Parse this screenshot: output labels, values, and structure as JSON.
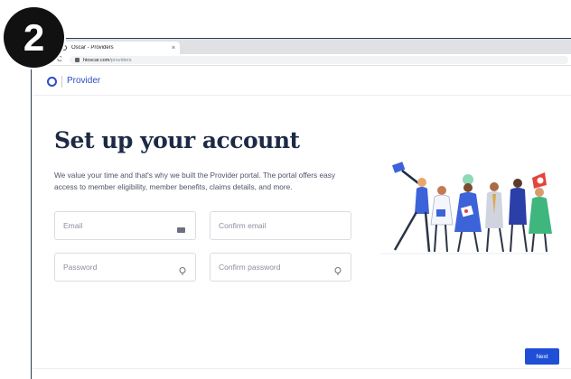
{
  "step": {
    "number": "2"
  },
  "browser": {
    "tab": {
      "title": "Oscar - Providers",
      "close": "×"
    },
    "address": {
      "reload": "C",
      "host": "hioscar.com",
      "path": "/providers"
    }
  },
  "header": {
    "brand": "Provider"
  },
  "main": {
    "title": "Set up your account",
    "subtitle": "We value your time and that's why we built the Provider portal. The portal offers easy access to member eligibility, member benefits, claims details, and more.",
    "fields": {
      "email": {
        "placeholder": "Email",
        "value": ""
      },
      "confirm_email": {
        "placeholder": "Confirm email",
        "value": ""
      },
      "password": {
        "placeholder": "Password",
        "value": ""
      },
      "confirm_password": {
        "placeholder": "Confirm password",
        "value": ""
      }
    }
  },
  "actions": {
    "next_label": "Next"
  },
  "colors": {
    "accent": "#1f4fd6",
    "brand": "#2b4dc8",
    "title": "#1c2a45"
  },
  "icons": [
    "oscar-logo-icon",
    "lock-icon",
    "reload-icon",
    "card-icon",
    "eye-icon"
  ]
}
